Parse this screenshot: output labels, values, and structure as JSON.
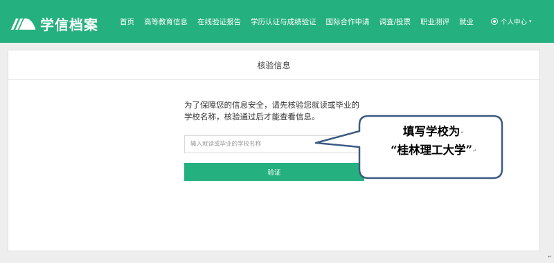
{
  "header": {
    "brand": "学信档案",
    "nav": [
      "首页",
      "高等教育信息",
      "在线验证报告",
      "学历认证与成绩验证",
      "国际合作申请",
      "调查/投票",
      "职业测评",
      "就业"
    ],
    "user_center": "个人中心",
    "caret": "▾"
  },
  "card": {
    "title": "核验信息",
    "intro_line1": "为了保障您的信息安全，请先核验您就读或毕业的",
    "intro_line2": "学校名称，核验通过后才能查看信息。",
    "input_placeholder": "输入就读或毕业的学校名称",
    "input_value": "",
    "verify_label": "验证"
  },
  "callout": {
    "line1": "填写学校为",
    "line2": "“桂林理工大学”",
    "edit_mark": "↵"
  },
  "colors": {
    "brand_green": "#24b07f",
    "callout_border": "#3c5a82"
  }
}
